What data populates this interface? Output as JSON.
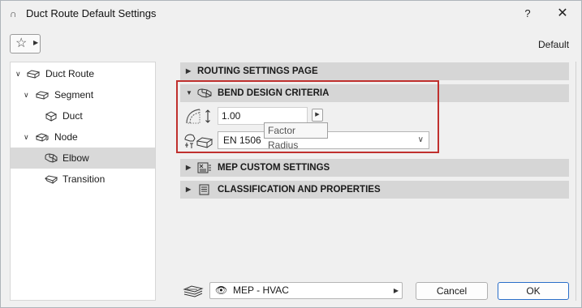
{
  "window": {
    "title": "Duct Route Default Settings",
    "app_icon": "∩",
    "help_label": "?",
    "close_label": "✕"
  },
  "toolbar": {
    "favorites_icon": "☆",
    "default_label": "Default"
  },
  "tree": {
    "items": [
      {
        "label": "Duct Route",
        "icon": "duct-route-icon",
        "expanded": true
      },
      {
        "label": "Segment",
        "icon": "segment-icon",
        "expanded": true
      },
      {
        "label": "Duct",
        "icon": "duct-icon"
      },
      {
        "label": "Node",
        "icon": "node-icon",
        "expanded": true
      },
      {
        "label": "Elbow",
        "icon": "elbow-icon",
        "selected": true
      },
      {
        "label": "Transition",
        "icon": "transition-icon"
      }
    ]
  },
  "sections": {
    "routing": {
      "label": "ROUTING SETTINGS PAGE",
      "expanded": false
    },
    "bend": {
      "label": "BEND DESIGN CRITERIA",
      "expanded": true
    },
    "mep": {
      "label": "MEP CUSTOM SETTINGS",
      "expanded": false
    },
    "classification": {
      "label": "CLASSIFICATION AND PROPERTIES",
      "expanded": false
    }
  },
  "bend": {
    "radius_value": "1.00",
    "tooltip": "Factor Radius",
    "standard_value": "EN 1506"
  },
  "footer": {
    "view_label": "MEP - HVAC",
    "cancel_label": "Cancel",
    "ok_label": "OK"
  },
  "colors": {
    "highlight_border": "#c0302e",
    "ok_border": "#2a6ec9",
    "selected_row": "#d9d9d9",
    "section_header": "#d6d6d6"
  }
}
